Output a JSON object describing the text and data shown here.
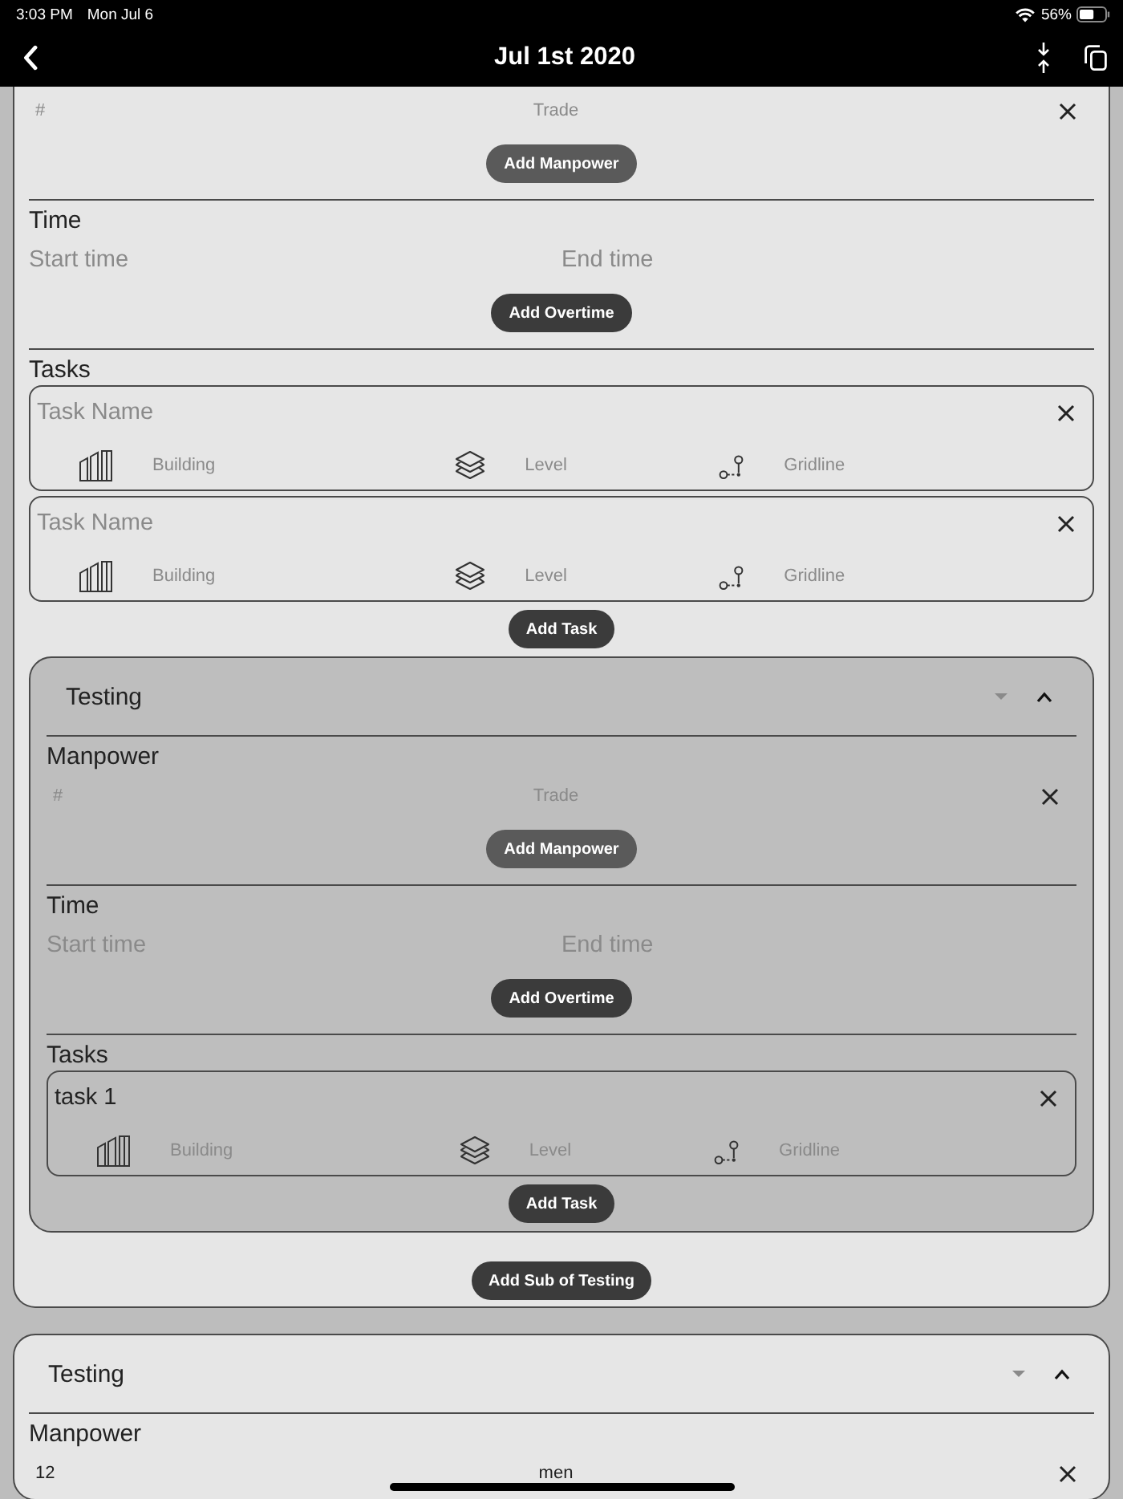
{
  "status_bar": {
    "time": "3:03 PM",
    "date": "Mon Jul 6",
    "battery": "56%"
  },
  "nav_bar": {
    "title": "Jul 1st 2020"
  },
  "sections": [
    {
      "manpower": {
        "rows": [
          {
            "count": {
              "placeholder": "#"
            },
            "trade": {
              "placeholder": "Trade"
            }
          }
        ],
        "button": {
          "label": "Add Manpower",
          "disabled": true
        }
      },
      "time": {
        "heading": "Time",
        "start": {
          "placeholder": "Start time"
        },
        "end": {
          "placeholder": "End time"
        },
        "button": {
          "label": "Add Overtime",
          "disabled": false
        }
      },
      "tasks": {
        "heading": "Tasks",
        "items": [
          {
            "name": {
              "placeholder": "Task Name"
            },
            "building": {
              "placeholder": "Building"
            },
            "level": {
              "placeholder": "Level"
            },
            "gridline": {
              "placeholder": "Gridline"
            }
          },
          {
            "name": {
              "placeholder": "Task Name"
            },
            "building": {
              "placeholder": "Building"
            },
            "level": {
              "placeholder": "Level"
            },
            "gridline": {
              "placeholder": "Gridline"
            }
          }
        ],
        "button": {
          "label": "Add Task",
          "disabled": false
        }
      },
      "children": [
        {
          "title": "Testing",
          "expanded": true,
          "manpower": {
            "heading": "Manpower",
            "rows": [
              {
                "count": {
                  "placeholder": "#"
                },
                "trade": {
                  "placeholder": "Trade"
                }
              }
            ],
            "button": {
              "label": "Add Manpower",
              "disabled": true
            }
          },
          "time": {
            "heading": "Time",
            "start": {
              "placeholder": "Start time"
            },
            "end": {
              "placeholder": "End time"
            },
            "button": {
              "label": "Add Overtime",
              "disabled": false
            }
          },
          "tasks": {
            "heading": "Tasks",
            "items": [
              {
                "name": {
                  "value": "task 1"
                },
                "building": {
                  "placeholder": "Building"
                },
                "level": {
                  "placeholder": "Level"
                },
                "gridline": {
                  "placeholder": "Gridline"
                }
              }
            ],
            "button": {
              "label": "Add Task",
              "disabled": false
            }
          }
        }
      ],
      "sub_button": {
        "label": "Add Sub of Testing",
        "disabled": false
      }
    },
    {
      "title": "Testing",
      "expanded": true,
      "manpower": {
        "heading": "Manpower",
        "rows": [
          {
            "count": {
              "value": "12"
            },
            "trade": {
              "value": "men"
            }
          }
        ]
      }
    }
  ]
}
